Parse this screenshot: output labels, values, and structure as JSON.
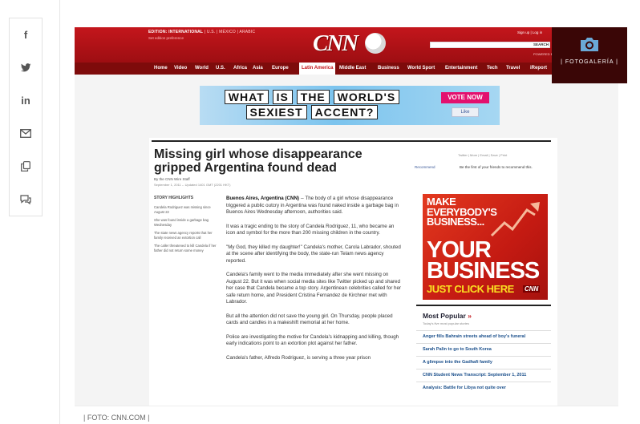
{
  "share": {
    "facebook_glyph": "f",
    "linkedin_glyph": "in",
    "icons": [
      "facebook-icon",
      "twitter-icon",
      "linkedin-icon",
      "email-icon",
      "copy-icon",
      "comment-icon"
    ]
  },
  "cnn": {
    "edition": "EDITION: INTERNATIONAL",
    "edition_links": "| U.S. | MÉXICO | ARABIC",
    "edition_sub": "Set edition preference",
    "logo": "CNN",
    "signin": "Sign up | Log in",
    "search_label": "SEARCH",
    "powered": "POWERED BY Google",
    "nav": [
      "Home",
      "Video",
      "World",
      "U.S.",
      "Africa",
      "Asia",
      "Europe",
      "Latin America",
      "Middle East",
      "Business",
      "World Sport",
      "Entertainment",
      "Tech",
      "Travel",
      "iReport"
    ],
    "nav_active": "Latin America"
  },
  "banner": {
    "line1_words": [
      "WHAT",
      "IS",
      "THE",
      "WORLD'S"
    ],
    "line2_words": [
      "SEXIEST",
      "ACCENT?"
    ],
    "vote": "VOTE NOW",
    "like": "Like"
  },
  "article": {
    "headline": "Missing girl whose disappearance gripped Argentina found dead",
    "byline": "By the CNN Wire Staff",
    "date": "September 1, 2011 -- Updated 1401 GMT (2201 HKT)",
    "tools": "Twitter | More | Email | Save | Print",
    "recommend": "Recommend",
    "recommend_text": "Be the first of your friends to recommend this.",
    "highlights_title": "STORY HIGHLIGHTS",
    "highlights": [
      "Candela Rodriguez was missing since August 22",
      "She was found inside a garbage bag Wednesday",
      "The state news agency reports that her family received an extortion call",
      "The caller threatened to kill Candela if her father did not return some money"
    ],
    "dateline": "Buenos Aires, Argentina (CNN)",
    "paragraphs": [
      "-- The body of a girl whose disappearance triggered a public outcry in Argentina was found naked inside a garbage bag in Buenos Aires Wednesday afternoon, authorities said.",
      "It was a tragic ending to the story of Candela Rodriguez, 11, who became an icon and symbol for the more than 200 missing children in the country.",
      "\"My God, they killed my daughter!\" Candela's mother, Carola Labrador, shouted at the scene after identifying the body, the state-run Telam news agency reported.",
      "Candela's family went to the media immediately after she went missing on August 22. But it was when social media sites like Twitter picked up and shared her case that Candela became a top story. Argentinean celebrities called for her safe return home, and President Cristina Fernandez de Kirchner met with Labrador.",
      "But all the attention did not save the young girl. On Thursday, people placed cards and candles in a makeshift memorial at her home.",
      "Police are investigating the motive for Candela's kidnapping and killing, though early indications point to an extortion plot against her father.",
      "Candela's father, Alfredo Rodriguez, is serving a three year prison"
    ]
  },
  "ad": {
    "line1": "MAKE",
    "line2": "EVERYBODY'S",
    "line3": "BUSINESS...",
    "big1": "YOUR",
    "big2": "BUSINESS",
    "cta": "JUST CLICK HERE",
    "brand": "CNN"
  },
  "most_popular": {
    "title": "Most Popular",
    "chevron": "»",
    "subtitle": "Today's five most popular stories",
    "items": [
      "Anger fills Bahrain streets ahead of boy's funeral",
      "Sarah Palin to go to South Korea",
      "A glimpse into the Gadhafi family",
      "CNN Student News Transcript: September 1, 2011",
      "Analysis: Battle for Libya not quite over"
    ]
  },
  "overlay": {
    "label": "| FOTOGALERÍA |"
  },
  "caption": "| FOTO: CNN.COM |",
  "colors": {
    "cnn_red": "#c4161c",
    "nav_dark": "#7e0b0b",
    "overlay": "#3a0606"
  }
}
